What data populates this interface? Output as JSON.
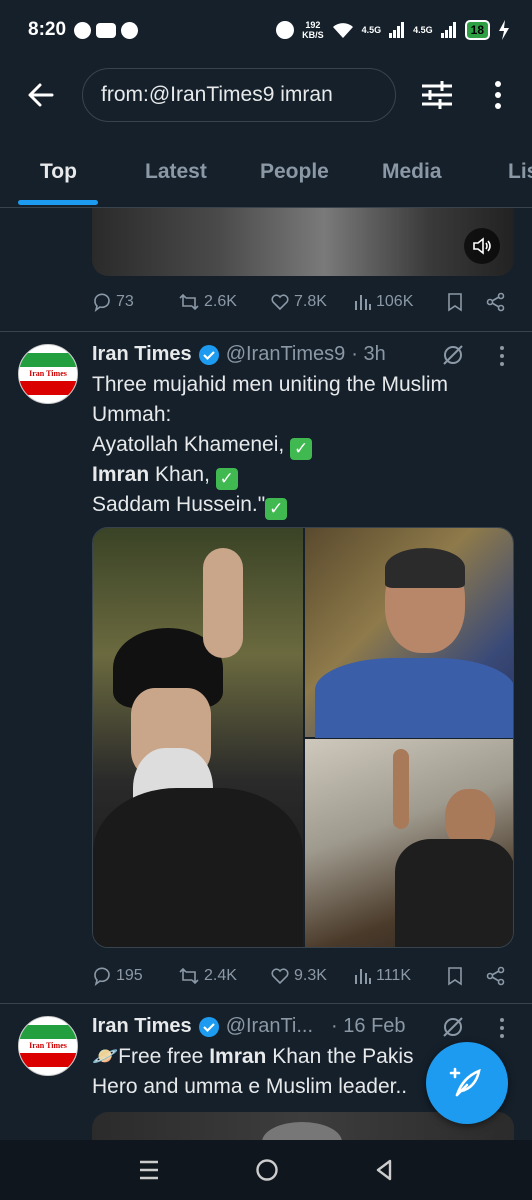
{
  "status_bar": {
    "time": "8:20",
    "speed_value": "192",
    "speed_unit": "KB/S",
    "signal1": "4.5G",
    "signal2": "4.5G",
    "battery": "18"
  },
  "search": {
    "query": "from:@IranTimes9 imran"
  },
  "tabs": [
    {
      "label": "Top"
    },
    {
      "label": "Latest"
    },
    {
      "label": "People"
    },
    {
      "label": "Media"
    },
    {
      "label": "Lis"
    }
  ],
  "previous_tweet": {
    "replies": "73",
    "reposts": "2.6K",
    "likes": "7.8K",
    "views": "106K"
  },
  "tweet1": {
    "name": "Iran Times",
    "handle": "@IranTimes9",
    "time": "· 3h",
    "avatar_label": "Iran Times",
    "line1": "Three mujahid men uniting the Muslim",
    "line2": "Ummah:",
    "line3": "Ayatollah Khamenei,",
    "line4_bold": "Imran",
    "line4_rest": " Khan,",
    "line5": "Saddam Hussein.\"",
    "replies": "195",
    "reposts": "2.4K",
    "likes": "9.3K",
    "views": "111K"
  },
  "tweet2": {
    "name": "Iran Times",
    "handle": "@IranTi...",
    "time": "· 16 Feb",
    "avatar_label": "Iran Times",
    "line1_emoji": "🪐",
    "line1_pre": "Free free ",
    "line1_bold": "Imran",
    "line1_rest": " Khan the Pakis",
    "line2": "Hero and umma e Muslim leader.."
  },
  "colors": {
    "background": "#15202b",
    "accent": "#1d9bf0",
    "secondary_text": "#8b98a5",
    "divider": "#38444d"
  }
}
